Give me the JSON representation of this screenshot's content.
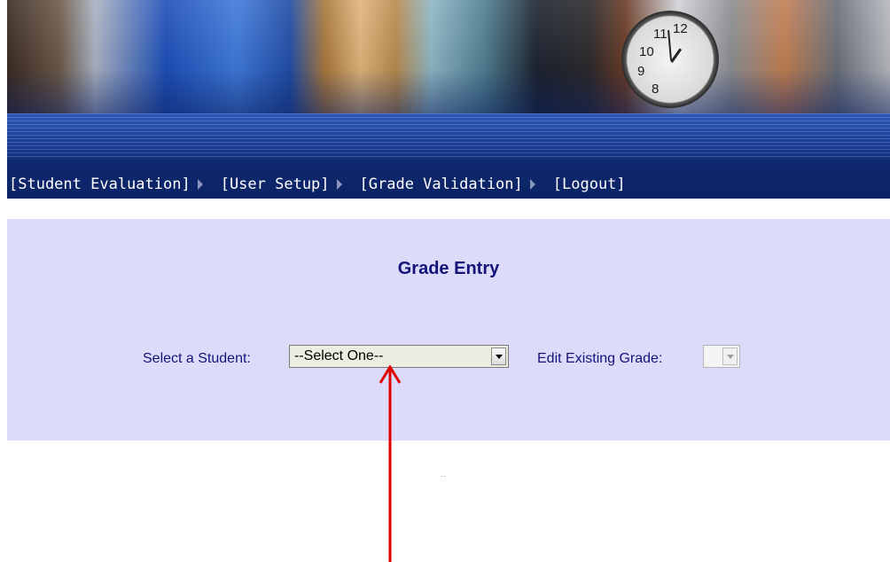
{
  "nav": {
    "items": [
      {
        "label": "[Student Evaluation]"
      },
      {
        "label": "[User Setup]"
      },
      {
        "label": "[Grade Validation]"
      },
      {
        "label": "[Logout]"
      }
    ]
  },
  "banner": {
    "clock_numbers": [
      "11",
      "12",
      "10",
      "9",
      "8"
    ]
  },
  "main": {
    "title": "Grade Entry",
    "student_label": "Select a Student:",
    "student_select_value": "--Select One--",
    "grade_label": "Edit Existing Grade:",
    "grade_select_value": ""
  },
  "footer": {
    "dots": ".."
  },
  "colors": {
    "nav_bg": "#0b2266",
    "panel_bg": "#dcdcfa",
    "title_text": "#13137a",
    "annotation": "#e00000"
  }
}
